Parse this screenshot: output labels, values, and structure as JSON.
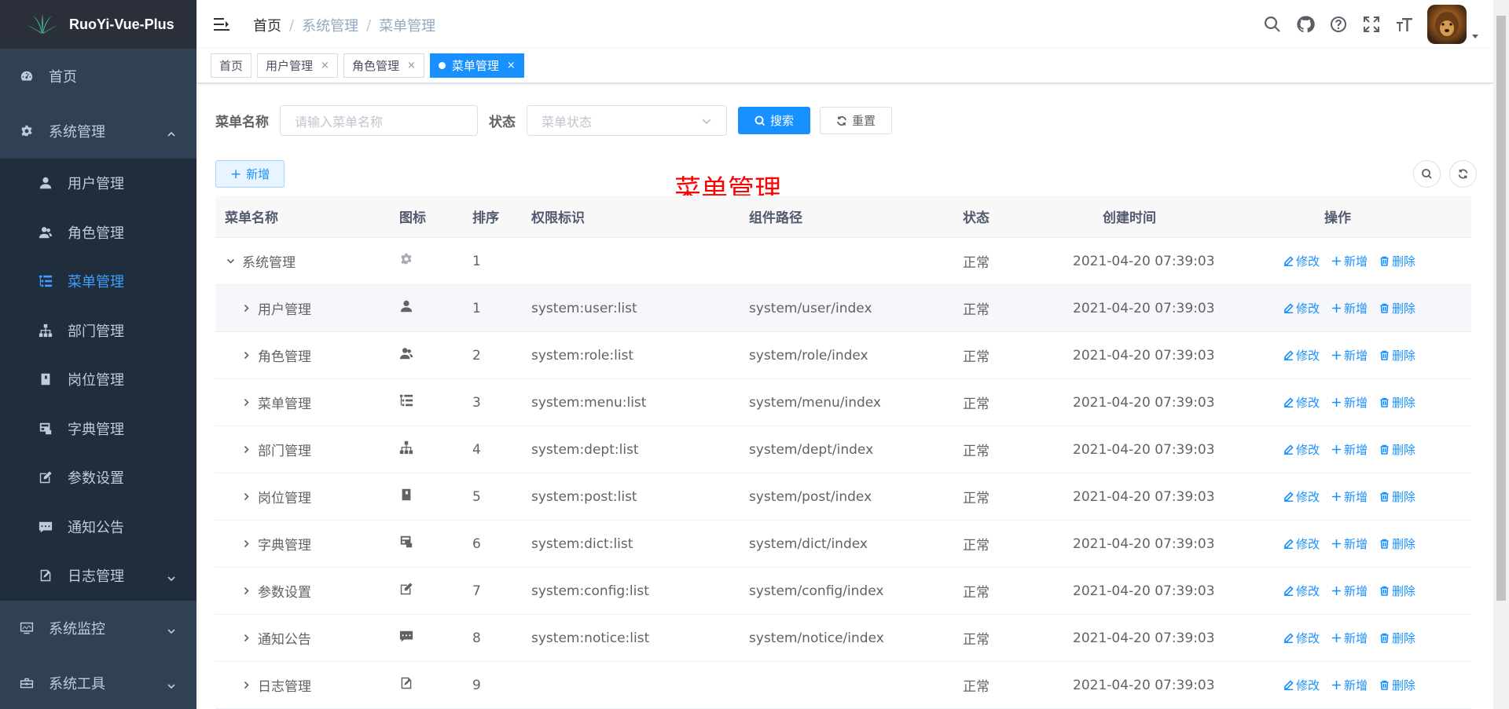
{
  "app": {
    "title": "RuoYi-Vue-Plus"
  },
  "sidebar": {
    "home": "首页",
    "system": "系统管理",
    "sub": [
      "用户管理",
      "角色管理",
      "菜单管理",
      "部门管理",
      "岗位管理",
      "字典管理",
      "参数设置",
      "通知公告",
      "日志管理"
    ],
    "monitor": "系统监控",
    "tools": "系统工具"
  },
  "breadcrumb": [
    "首页",
    "系统管理",
    "菜单管理"
  ],
  "tags": [
    "首页",
    "用户管理",
    "角色管理",
    "菜单管理"
  ],
  "search": {
    "name_label": "菜单名称",
    "name_placeholder": "请输入菜单名称",
    "status_label": "状态",
    "status_placeholder": "菜单状态",
    "search_btn": "搜索",
    "reset_btn": "重置"
  },
  "add_btn": "新增",
  "overlay_title": "菜单管理",
  "table": {
    "headers": [
      "菜单名称",
      "图标",
      "排序",
      "权限标识",
      "组件路径",
      "状态",
      "创建时间",
      "操作"
    ],
    "ops": [
      "修改",
      "新增",
      "删除"
    ],
    "rows": [
      {
        "name": "系统管理",
        "order": "1",
        "perm": "",
        "path": "",
        "status": "正常",
        "time": "2021-04-20 07:39:03"
      },
      {
        "name": "用户管理",
        "order": "1",
        "perm": "system:user:list",
        "path": "system/user/index",
        "status": "正常",
        "time": "2021-04-20 07:39:03"
      },
      {
        "name": "角色管理",
        "order": "2",
        "perm": "system:role:list",
        "path": "system/role/index",
        "status": "正常",
        "time": "2021-04-20 07:39:03"
      },
      {
        "name": "菜单管理",
        "order": "3",
        "perm": "system:menu:list",
        "path": "system/menu/index",
        "status": "正常",
        "time": "2021-04-20 07:39:03"
      },
      {
        "name": "部门管理",
        "order": "4",
        "perm": "system:dept:list",
        "path": "system/dept/index",
        "status": "正常",
        "time": "2021-04-20 07:39:03"
      },
      {
        "name": "岗位管理",
        "order": "5",
        "perm": "system:post:list",
        "path": "system/post/index",
        "status": "正常",
        "time": "2021-04-20 07:39:03"
      },
      {
        "name": "字典管理",
        "order": "6",
        "perm": "system:dict:list",
        "path": "system/dict/index",
        "status": "正常",
        "time": "2021-04-20 07:39:03"
      },
      {
        "name": "参数设置",
        "order": "7",
        "perm": "system:config:list",
        "path": "system/config/index",
        "status": "正常",
        "time": "2021-04-20 07:39:03"
      },
      {
        "name": "通知公告",
        "order": "8",
        "perm": "system:notice:list",
        "path": "system/notice/index",
        "status": "正常",
        "time": "2021-04-20 07:39:03"
      },
      {
        "name": "日志管理",
        "order": "9",
        "perm": "",
        "path": "",
        "status": "正常",
        "time": "2021-04-20 07:39:03"
      }
    ]
  },
  "colors": {
    "sidebar_bg": "#304156",
    "submenu_bg": "#1f2d3d",
    "primary": "#1890ff",
    "overlay_title": "#ff0000"
  }
}
